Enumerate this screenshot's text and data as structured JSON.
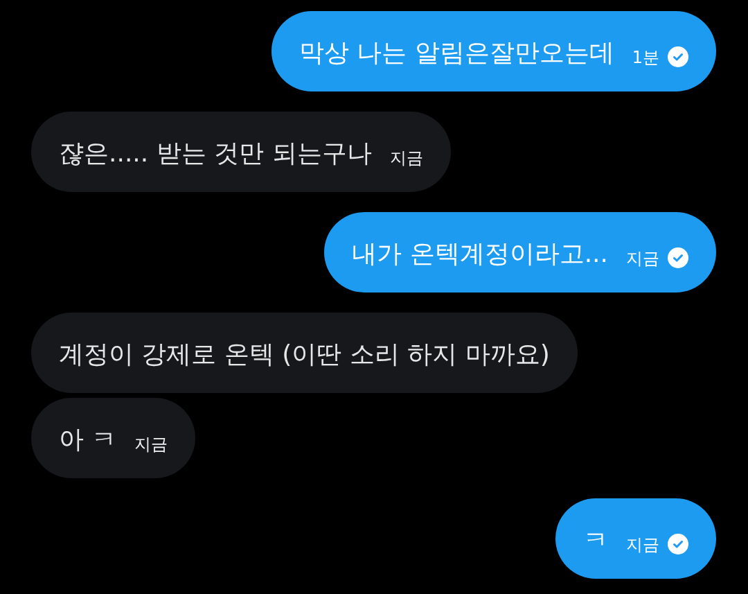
{
  "messages": [
    {
      "kind": "sent",
      "text": "막상 나는 알림은잘만오는데",
      "time": "1분",
      "read": true
    },
    {
      "kind": "received",
      "text": "쟎은..... 받는 것만 되는구나",
      "time": "지금"
    },
    {
      "kind": "sent",
      "text": "내가 온텍계정이라고...",
      "time": "지금",
      "read": true
    },
    {
      "kind": "received",
      "text": "계정이 강제로 온텍 (이딴 소리 하지 마까요)"
    },
    {
      "kind": "received",
      "text": "아 ㅋ",
      "time": "지금"
    },
    {
      "kind": "sent",
      "text": "ㅋ",
      "time": "지금",
      "read": true
    }
  ]
}
